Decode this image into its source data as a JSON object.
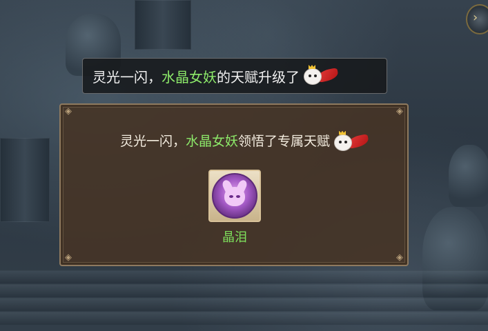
{
  "toast": {
    "prefix": "灵光一闪，",
    "hero_name": "水晶女妖",
    "suffix": "的天赋升级了"
  },
  "dialog": {
    "prefix": "灵光一闪，",
    "hero_name": "水晶女妖",
    "suffix": "领悟了专属天赋"
  },
  "skill": {
    "name": "晶泪",
    "icon": "crystal-banshee-icon"
  },
  "emote_icon": "cute-mascot-emote-icon",
  "colors": {
    "highlight_green": "#8dea6a",
    "panel_brown": "#463426",
    "panel_border": "#8f7a5f"
  }
}
